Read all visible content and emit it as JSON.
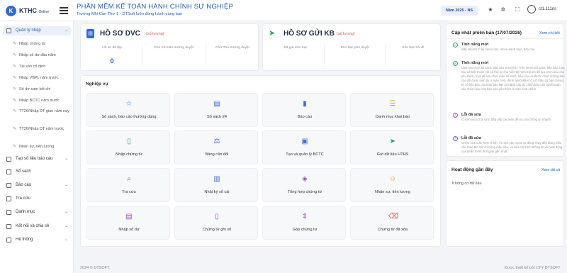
{
  "brand": {
    "name": "KTHC",
    "suffix": "Online"
  },
  "app": {
    "title": "PHẦN MỀM KẾ TOÁN HÀNH CHÍNH SỰ NGHIỆP",
    "subtitle": "Trường MN Cần Thơ 1 - DTSoft luôn đồng hành cùng bạn"
  },
  "topbar": {
    "year": "Năm 2025 - NS",
    "username": "ct1.111ns"
  },
  "sidebar": {
    "items": [
      {
        "label": "Quản lý nhập",
        "active": true
      },
      {
        "label": "Tạo số liệu báo cáo"
      },
      {
        "label": "Sổ sách"
      },
      {
        "label": "Báo cáo"
      },
      {
        "label": "Tra cứu"
      },
      {
        "label": "Danh mục"
      },
      {
        "label": "Kết nối và chia sẻ"
      },
      {
        "label": "Hệ thống"
      }
    ],
    "subitems": [
      "Nhập chứng từ",
      "Nhập số dư đầu năm",
      "Tài sản cố định",
      "Nhập VBPL năm trước",
      "Số dư cam kết chi",
      "Nhập BCTC năm trước",
      "TT26/Nhập DT giao năm nay",
      "TT26/Nhập DT năm trước",
      "Nhân sự, tiền lương"
    ]
  },
  "dvc": {
    "title": "HỒ SƠ DVC",
    "qty_label": "(số lượng)",
    "columns": [
      {
        "label": "Hồ sơ đã lập",
        "value": "0"
      },
      {
        "label": "Chờ Kế toán trưởng duyệt",
        "value": ""
      },
      {
        "label": "Chờ Thủ trưởng duyệt",
        "value": ""
      }
    ]
  },
  "kb": {
    "title": "HỒ SƠ GỬI KB",
    "qty_label": "(số lượng)",
    "columns": [
      {
        "label": "Đã gửi Kho bạc"
      },
      {
        "label": "Kho bạc phê duyệt"
      },
      {
        "label": "Kho bạc trả về"
      }
    ]
  },
  "operations": {
    "title": "Nghiệp vụ",
    "tiles": [
      {
        "label": "Sổ sách, báo cáo thường dùng",
        "icon": "star-icon",
        "color": "#3b6fd6",
        "glyph": "☆"
      },
      {
        "label": "Sổ sách 24",
        "icon": "book-icon",
        "color": "#3b6fd6",
        "glyph": "▤"
      },
      {
        "label": "Báo cáo",
        "icon": "bar-chart-icon",
        "color": "#3b6fd6",
        "glyph": "▮"
      },
      {
        "label": "Danh mục khai báo",
        "icon": "list-icon",
        "color": "#e0a020",
        "glyph": "☰"
      },
      {
        "label": "Nhập chứng từ",
        "icon": "document-icon",
        "color": "#2aa65a",
        "glyph": "▯"
      },
      {
        "label": "Bảng cân đối",
        "icon": "scale-icon",
        "color": "#3b6fd6",
        "glyph": "⚖"
      },
      {
        "label": "Tạo và quản lý BCTC",
        "icon": "folder-plus-icon",
        "color": "#3b6fd6",
        "glyph": "▣"
      },
      {
        "label": "Gửi dữ liệu HTHS",
        "icon": "send-icon",
        "color": "#2aa65a",
        "glyph": "➤"
      },
      {
        "label": "Tra cứu",
        "icon": "search-icon",
        "color": "#3b6fd6",
        "glyph": "⌕"
      },
      {
        "label": "Nhật ký sổ cái",
        "icon": "journal-icon",
        "color": "#3b6fd6",
        "glyph": "▥"
      },
      {
        "label": "Tổng hợp chứng từ",
        "icon": "layers-icon",
        "color": "#8a4fd6",
        "glyph": "◈"
      },
      {
        "label": "Nhân sự, tiền lương",
        "icon": "users-icon",
        "color": "#e0a020",
        "glyph": "☺"
      },
      {
        "label": "Nhập số dư",
        "icon": "receipt-icon",
        "color": "#8a4fd6",
        "glyph": "▤"
      },
      {
        "label": "Chứng từ ghi sổ",
        "icon": "file-text-icon",
        "color": "#8a4fd6",
        "glyph": "▯"
      },
      {
        "label": "Gộp chứng từ",
        "icon": "merge-icon",
        "color": "#8a4fd6",
        "glyph": "⇕"
      },
      {
        "label": "Chứng từ đã xóa",
        "icon": "trash-icon",
        "color": "#d9534f",
        "glyph": "⌫"
      }
    ]
  },
  "updates": {
    "title": "Cập nhật phiên bản (17/07/2026)",
    "view_all": "Xem chi tiết",
    "items": [
      {
        "type": "new",
        "title": "Tính năng mới",
        "desc": "Sắp xếp bố trí lại menu dọc, menu danh mục, báo cáo"
      },
      {
        "type": "new",
        "title": "Tính năng mới",
        "desc": "Làm lựa chọn số sách, báo cáo yêu thích: Trên menu Số sách, báo cáo, báo cáo cả biệt trước cột số thứ tự cho hiển thị hình trái tim để lựa chọn báo cáo yêu thích, mục để lựa chọn mẫu sổ sách, báo cáo ưa thích: chọn những báo cáo để được hiển thị ở màn hình chính NHOMBAOCAO Mẫu cả biệt chứng từ số liệu báo cáo khai báo NĐ 347/Báo cáo thì chỉnh báo cáo quyết toán', các nhóm báo cáo báo cáo yêu thích ở màn hình chính"
      },
      {
        "type": "fix",
        "title": "Lỗi đã sửa",
        "desc": "Chỉnh menu Tra cứu: Sắp xếp các kiểu để tra cứu thông tin nhanh"
      },
      {
        "type": "fix",
        "title": "Lỗi đã sửa",
        "desc": "Chỉnh sửa màn hình chính: Ẩn tích các menu tự động chạy đến đúng mẫu cần thao tác chính không mẫu nếu, và hiển thị thêm thông tin về hoạt động của phần mềm thời gian gần nhất"
      }
    ]
  },
  "activity": {
    "title": "Hoạt động gần đây",
    "view_all": "Xem tất cả",
    "empty": "Không có dữ liệu"
  },
  "footer": {
    "left": "2024 © DTSOFT.",
    "right": "Được thiết kế bởi CTY DTSOFT"
  }
}
